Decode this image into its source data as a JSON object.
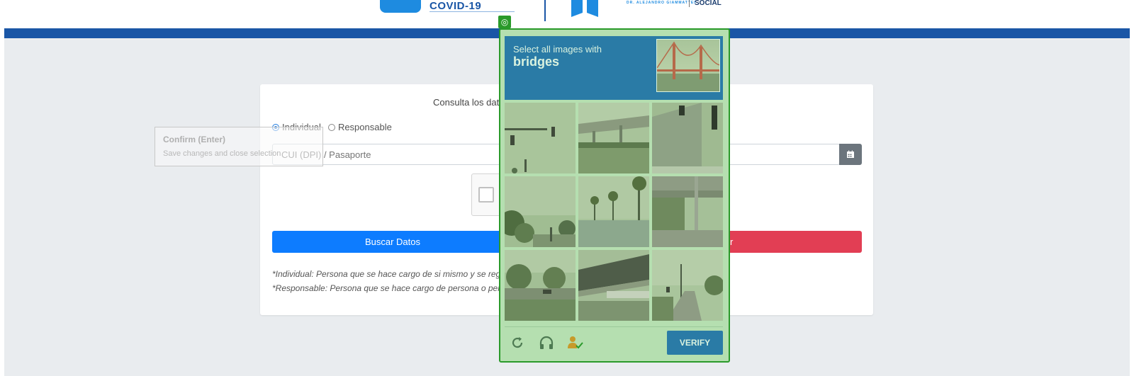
{
  "header": {
    "covid_logo_text": "COVID-19",
    "logo_subtext": "DR. ALEJANDRO GIAMMATTEI",
    "logo_social": "SOCIAL"
  },
  "form": {
    "title": "Consulta los dato",
    "radio_individual": "Individual",
    "radio_responsable": "Responsable",
    "doc_placeholder": "CUI (DPI) / Pasaporte",
    "buscar_label": "Buscar Datos",
    "red_button_label": "r",
    "note_individual": "*Individual: Persona que se hace cargo de si mismo y se regist",
    "note_responsable": "*Responsable: Persona que se hace cargo de persona o perso"
  },
  "tooltip": {
    "title": "Confirm (Enter)",
    "subtitle": "Save changes and close selection"
  },
  "captcha": {
    "prompt": "Select all images with",
    "keyword": "bridges",
    "verify_label": "VERIFY",
    "icons": [
      "refresh-icon",
      "headphones-icon",
      "accessibility-icon"
    ],
    "accent_color": "#2a7ba6",
    "overlay_color": "#b5dfb0"
  }
}
